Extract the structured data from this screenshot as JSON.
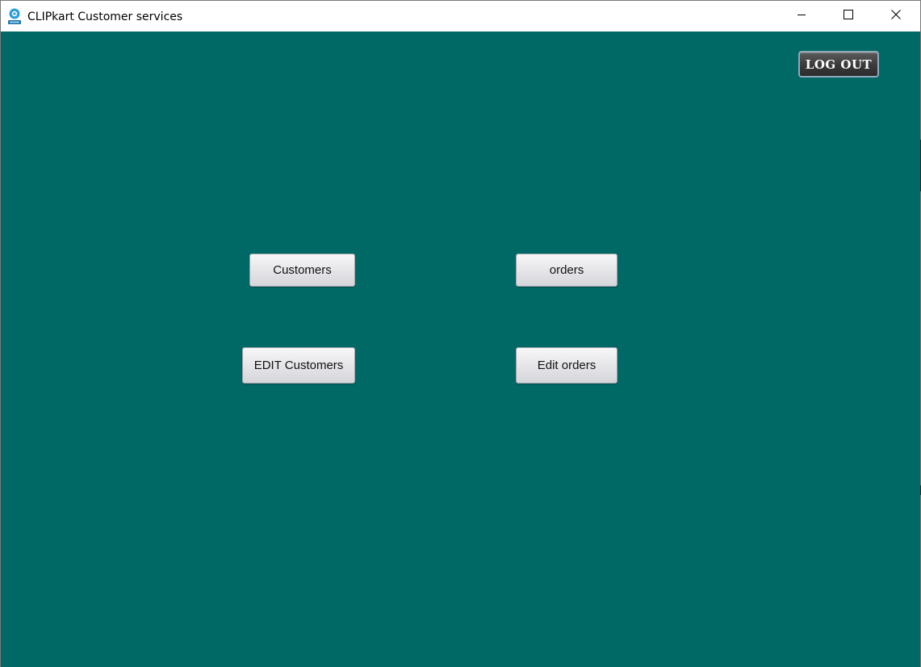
{
  "window": {
    "title": "CLIPkart Customer services",
    "icon": "clipkart-app-icon",
    "controls": {
      "minimize_icon": "minimize-icon",
      "maximize_icon": "maximize-icon",
      "close_icon": "close-icon"
    }
  },
  "colors": {
    "background": "#006865",
    "logout_button": "#3a3a3a",
    "action_button": "#e6e6e9"
  },
  "header": {
    "logout_label": "LOG OUT"
  },
  "main": {
    "buttons": {
      "customers": "Customers",
      "orders": "orders",
      "edit_customers": "EDIT Customers",
      "edit_orders": "Edit orders"
    }
  }
}
